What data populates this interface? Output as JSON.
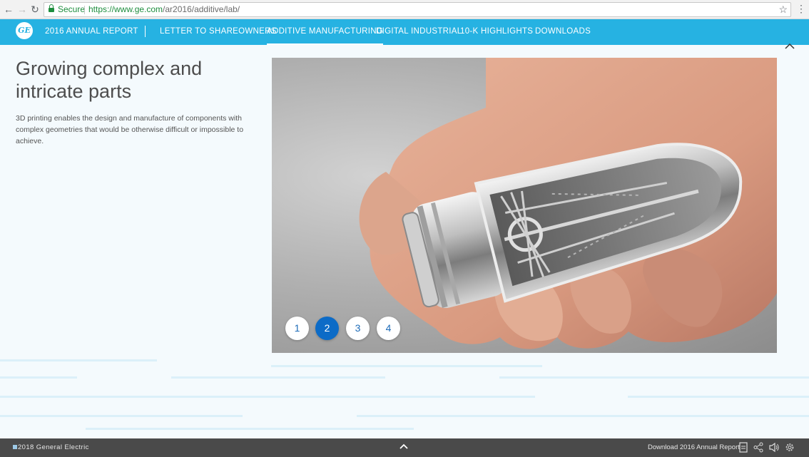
{
  "browser": {
    "secure_label": "Secure",
    "url_scheme_host": "https://www.ge.com",
    "url_path": "/ar2016/additive/lab/"
  },
  "nav": {
    "logo_text": "GE",
    "items": [
      {
        "label": "2016 ANNUAL REPORT"
      },
      {
        "label": "LETTER TO SHAREOWNERS"
      },
      {
        "label": "ADDITIVE MANUFACTURING",
        "active": true
      },
      {
        "label": "DIGITAL INDUSTRIAL"
      },
      {
        "label": "10-K HIGHLIGHTS"
      },
      {
        "label": "DOWNLOADS"
      }
    ],
    "brand_color": "#26b2e2"
  },
  "content": {
    "headline": "Growing complex and intricate parts",
    "body": "3D printing enables the design and manufacture of components with complex geometries that would be otherwise difficult or impossible to achieve."
  },
  "gallery": {
    "pages": [
      "1",
      "2",
      "3",
      "4"
    ],
    "active_page": "2",
    "active_color": "#0c6bc7"
  },
  "footer": {
    "copyright": "2018 General Electric",
    "download_label": "Download 2016 Annual Report",
    "icons": [
      "pdf-icon",
      "share-icon",
      "sound-icon",
      "settings-icon"
    ]
  }
}
